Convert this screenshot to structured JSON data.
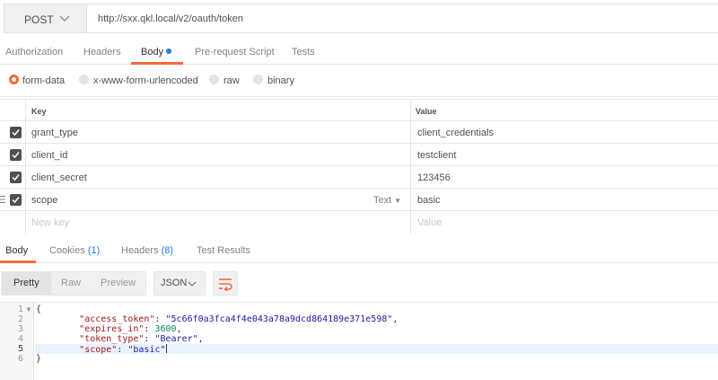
{
  "request": {
    "method": "POST",
    "url": "http://sxx.qkl.local/v2/oauth/token"
  },
  "request_tabs": [
    "Authorization",
    "Headers",
    "Body",
    "Pre-request Script",
    "Tests"
  ],
  "body_types": [
    "form-data",
    "x-www-form-urlencoded",
    "raw",
    "binary"
  ],
  "table": {
    "key_header": "Key",
    "value_header": "Value",
    "rows": [
      {
        "key": "grant_type",
        "value": "client_credentials"
      },
      {
        "key": "client_id",
        "value": "testclient"
      },
      {
        "key": "client_secret",
        "value": "123456"
      },
      {
        "key": "scope",
        "value": "basic",
        "type": "Text"
      }
    ],
    "new_key_placeholder": "New key",
    "new_value_placeholder": "Value"
  },
  "response_tabs": {
    "body": "Body",
    "cookies": "Cookies",
    "cookies_count": "(1)",
    "headers": "Headers",
    "headers_count": "(8)",
    "test_results": "Test Results"
  },
  "view": {
    "modes": [
      "Pretty",
      "Raw",
      "Preview"
    ],
    "format": "JSON"
  },
  "response": {
    "line_numbers": [
      "1",
      "2",
      "3",
      "4",
      "5",
      "6"
    ],
    "open_brace": "{",
    "close_brace": "}",
    "fields": [
      {
        "key": "\"access_token\"",
        "value": "\"5c66f0a3fca4f4e043a78a9dcd864189e371e598\"",
        "kind": "string",
        "comma": ","
      },
      {
        "key": "\"expires_in\"",
        "value": "3600",
        "kind": "number",
        "comma": ","
      },
      {
        "key": "\"token_type\"",
        "value": "\"Bearer\"",
        "kind": "string",
        "comma": ","
      },
      {
        "key": "\"scope\"",
        "value": "\"basic\"",
        "kind": "string",
        "comma": ""
      }
    ]
  },
  "colors": {
    "accent": "#f26b3a",
    "link": "#1c7fe0"
  }
}
